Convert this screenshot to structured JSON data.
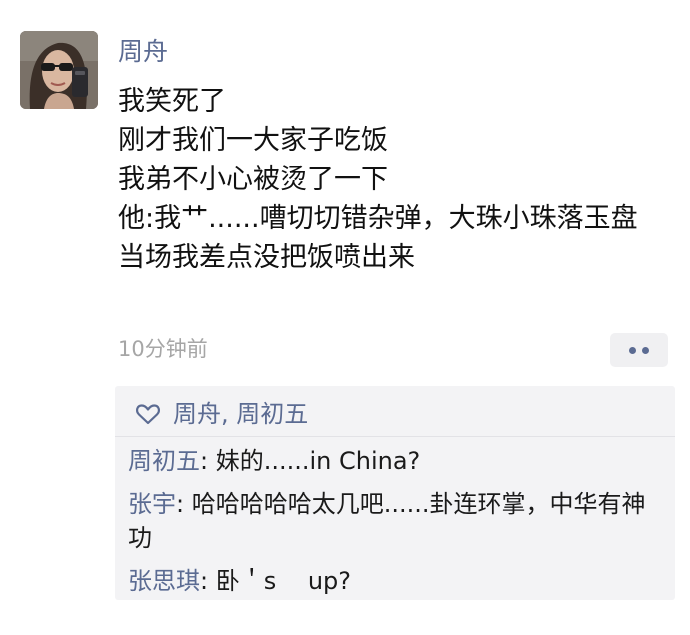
{
  "post": {
    "author": "周舟",
    "lines": [
      "我笑死了",
      "刚才我们一大家子吃饭",
      "我弟不小心被烫了一下",
      "他:我艹......嘈切切错杂弹，大珠小珠落玉盘",
      "当场我差点没把饭喷出来"
    ],
    "timestamp": "10分钟前",
    "more_icon": "ellipsis-icon"
  },
  "likes": {
    "icon": "heart-outline-icon",
    "names": "周舟, 周初五"
  },
  "comments": [
    {
      "name": "周初五",
      "separator": ": ",
      "text": "妹的......in China?"
    },
    {
      "name": "张宇",
      "separator": ": ",
      "text": "哈哈哈哈哈太几吧......卦连环掌，中华有神功"
    },
    {
      "name": "张思琪",
      "separator": ": ",
      "text": "卧＇s　 up?"
    }
  ],
  "colors": {
    "link": "#5b6b92",
    "text": "#111111",
    "muted": "#a6a6a6",
    "comment_bg": "#f3f3f5"
  }
}
